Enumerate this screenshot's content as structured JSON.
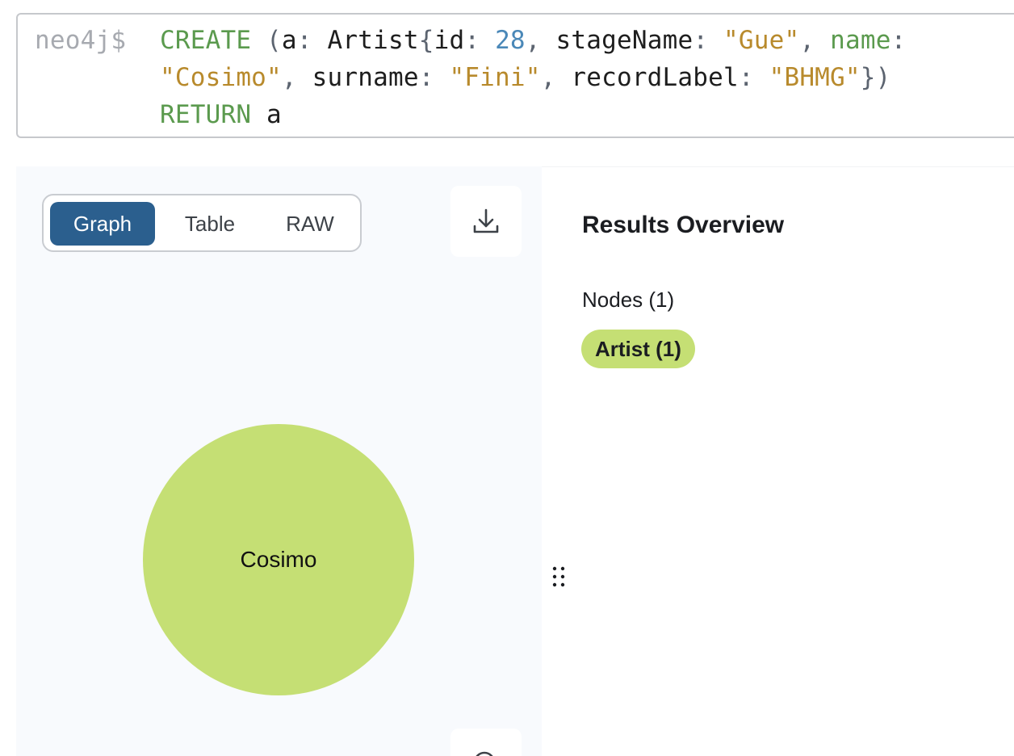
{
  "editor": {
    "prompt": "neo4j$",
    "tokens": {
      "create": "CREATE",
      "open_paren": " (",
      "var_a": "a",
      "colon1": ": ",
      "label": "Artist",
      "open_brace": "{",
      "k_id": "id",
      "sep_id": ": ",
      "v_id": "28",
      "comma1": ", ",
      "k_stage": "stageName",
      "sep_stage": ": ",
      "v_stage": "\"Gue\"",
      "comma2": ", ",
      "k_name": "name",
      "sep_name": ":",
      "v_name": "\"Cosimo\"",
      "comma3": ", ",
      "k_surname": "surname",
      "sep_surname": ": ",
      "v_surname": "\"Fini\"",
      "comma4": ", ",
      "k_label": "recordLabel",
      "sep_label": ": ",
      "v_label": "\"BHMG\"",
      "close": "})",
      "return_kw": "RETURN",
      "return_var": " a"
    }
  },
  "view_toggle": {
    "graph": "Graph",
    "table": "Table",
    "raw": "RAW",
    "active": "Graph"
  },
  "graph": {
    "node_caption": "Cosimo",
    "node_color": "#c5df74"
  },
  "results": {
    "title": "Results Overview",
    "nodes_label": "Nodes (1)",
    "label_chip": "Artist (1)"
  },
  "colors": {
    "active_toggle": "#2b5f8e",
    "keyword": "#5b9a4e",
    "number": "#4a88b8",
    "string": "#b88a2c"
  },
  "icons": {
    "download": "download-icon",
    "drag": "drag-handle-icon",
    "zoom": "zoom-icon"
  }
}
